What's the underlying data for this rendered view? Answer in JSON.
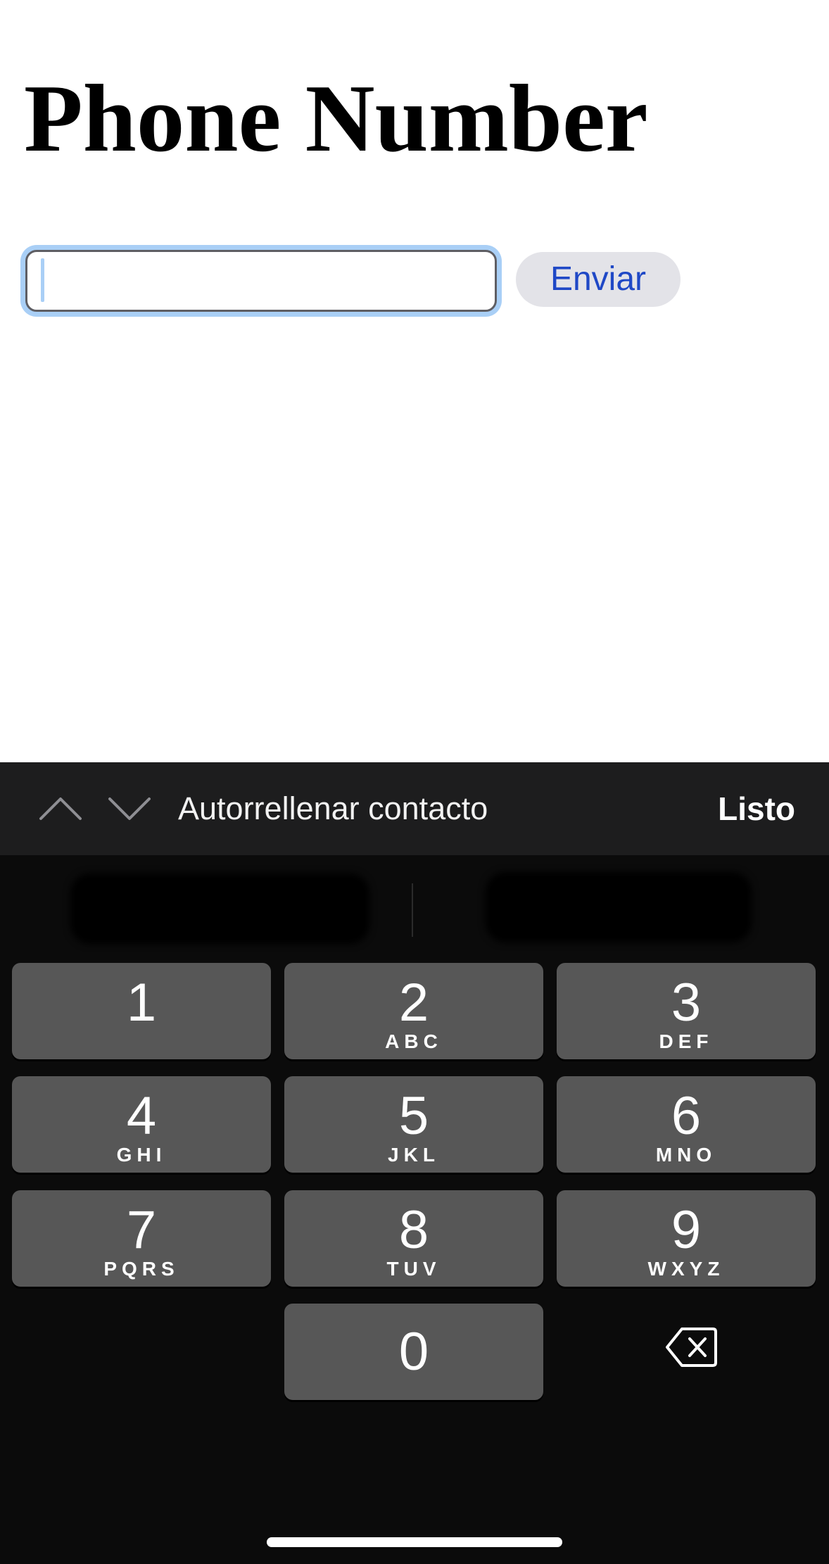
{
  "page": {
    "title": "Phone Number"
  },
  "form": {
    "phone_value": "",
    "submit_label": "Enviar"
  },
  "accessory_bar": {
    "previous_icon": "chevron-up-icon",
    "next_icon": "chevron-down-icon",
    "autofill_label": "Autorrellenar contacto",
    "done_label": "Listo"
  },
  "keypad": {
    "keys": [
      {
        "digit": "1",
        "letters": ""
      },
      {
        "digit": "2",
        "letters": "ABC"
      },
      {
        "digit": "3",
        "letters": "DEF"
      },
      {
        "digit": "4",
        "letters": "GHI"
      },
      {
        "digit": "5",
        "letters": "JKL"
      },
      {
        "digit": "6",
        "letters": "MNO"
      },
      {
        "digit": "7",
        "letters": "PQRS"
      },
      {
        "digit": "8",
        "letters": "TUV"
      },
      {
        "digit": "9",
        "letters": "WXYZ"
      },
      {
        "digit": "0",
        "letters": ""
      }
    ],
    "backspace_icon": "backspace-icon"
  },
  "colors": {
    "focus_ring": "#a9cff6",
    "link_blue": "#1f48c6",
    "key_bg": "#575757",
    "keyboard_bg": "#0b0b0b"
  }
}
